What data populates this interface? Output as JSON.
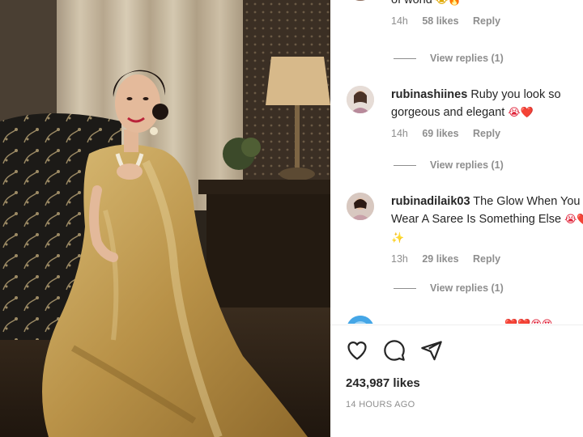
{
  "comments": [
    {
      "user": "",
      "text": "of world",
      "emojis": "😭🔥",
      "time": "14h",
      "likes": "58 likes",
      "reply_label": "Reply",
      "view_replies": "View replies (1)"
    },
    {
      "user": "rubinashiines",
      "text": "Ruby you look so gorgeous and elegant",
      "emojis": "😭❤️",
      "time": "14h",
      "likes": "69 likes",
      "reply_label": "Reply",
      "view_replies": "View replies (1)"
    },
    {
      "user": "rubinadilaik03",
      "text": "The Glow When You Wear A Saree Is Something Else",
      "emojis": "😭❤️✨",
      "time": "13h",
      "likes": "29 likes",
      "reply_label": "Reply",
      "view_replies": "View replies (1)"
    },
    {
      "user": "",
      "text": "",
      "emojis": "❤️❤️😍😍",
      "time": "",
      "likes": "",
      "reply_label": "",
      "view_replies": ""
    }
  ],
  "actions": {
    "like_icon": "heart-outline-icon",
    "comment_icon": "comment-bubble-icon",
    "share_icon": "paper-plane-icon"
  },
  "post": {
    "likes": "243,987 likes",
    "time": "14 HOURS AGO"
  },
  "colors": {
    "text": "#262626",
    "secondary": "#8e8e8e",
    "heart": "#e0243a",
    "saree_gold": "#c8a45c"
  }
}
